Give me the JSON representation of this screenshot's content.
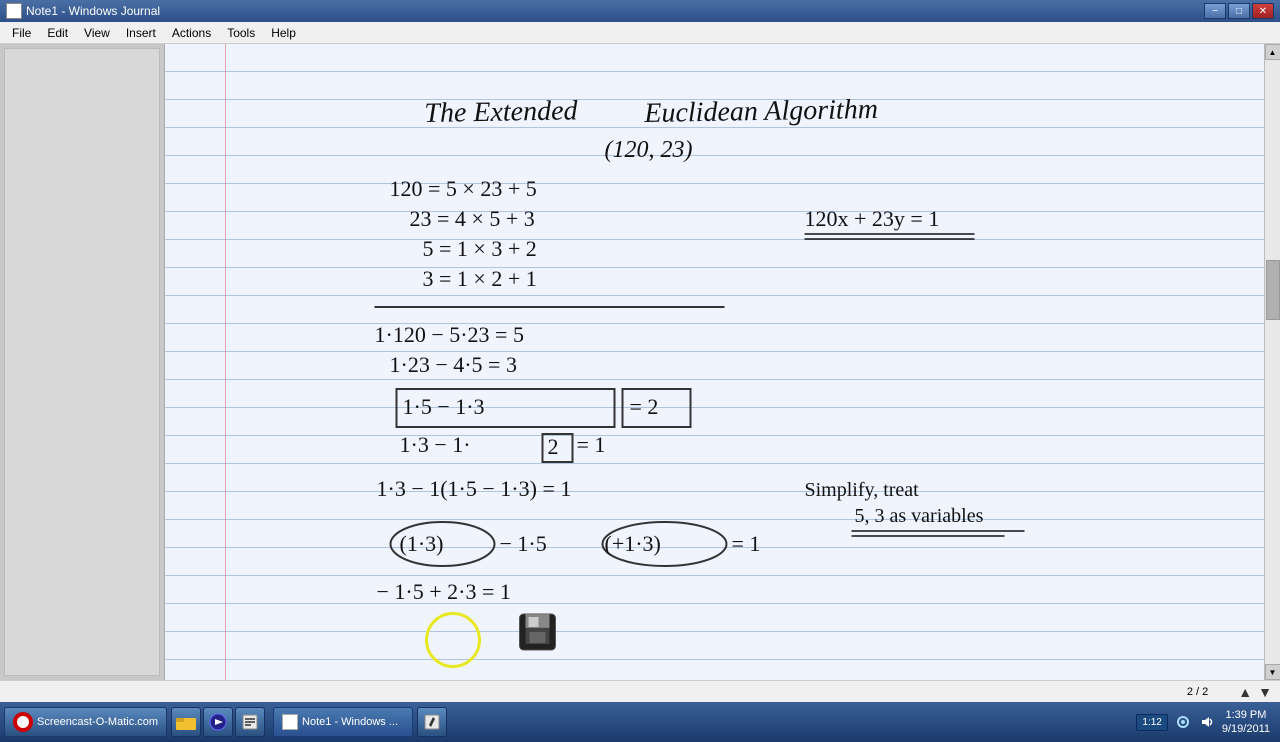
{
  "titleBar": {
    "title": "Note1 - Windows Journal",
    "minimizeLabel": "−",
    "maximizeLabel": "□",
    "closeLabel": "✕"
  },
  "menuBar": {
    "items": [
      "File",
      "Edit",
      "View",
      "Insert",
      "Actions",
      "Tools",
      "Help"
    ]
  },
  "notebook": {
    "content": "The Extended Euclidean Algorithm",
    "pageIndicator": "2 / 2"
  },
  "taskbar": {
    "screencastLabel": "Screencast-O-Matic.com",
    "activeWindow": "Note1 - Windows ...",
    "time": "1:39 PM",
    "date": "9/19/2011",
    "keyboard": "1:12"
  }
}
